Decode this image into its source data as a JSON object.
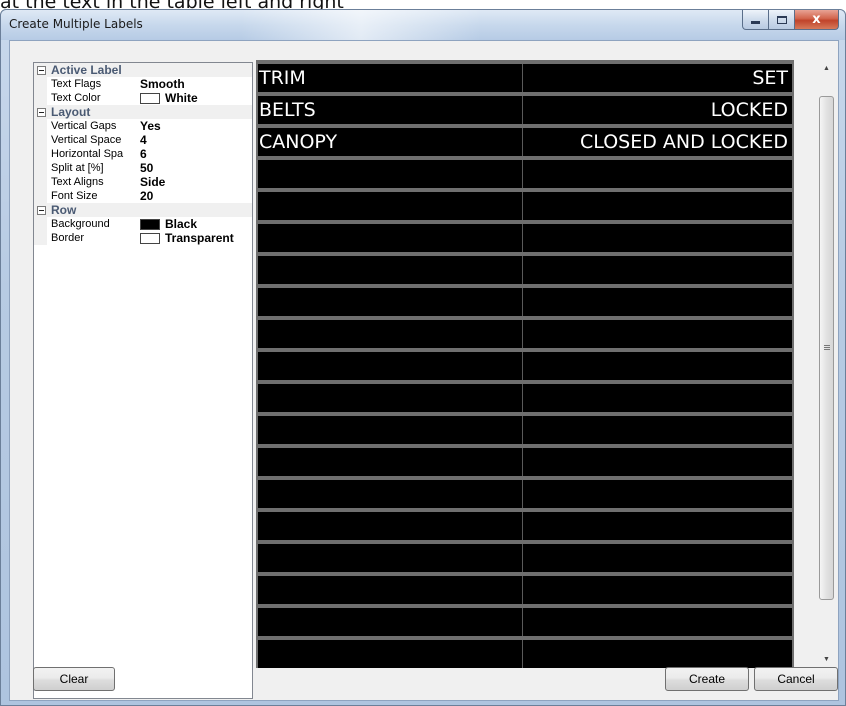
{
  "backdrop_text": "at the text in the table left and right",
  "window": {
    "title": "Create Multiple Labels",
    "minimize_glyph": "",
    "maximize_glyph": "",
    "close_glyph": "x"
  },
  "property_grid": {
    "categories": [
      {
        "label": "Active Label",
        "properties": [
          {
            "name": "Text Flags",
            "value": "Smooth"
          },
          {
            "name": "Text Color",
            "value": "White",
            "swatch": "#ffffff"
          }
        ]
      },
      {
        "label": "Layout",
        "properties": [
          {
            "name": "Vertical Gaps",
            "value": "Yes"
          },
          {
            "name": "Vertical Space",
            "value": "4"
          },
          {
            "name": "Horizontal Spa",
            "value": "6"
          },
          {
            "name": "Split at [%]",
            "value": "50"
          },
          {
            "name": "Text Aligns",
            "value": "Side"
          },
          {
            "name": "Font Size",
            "value": "20"
          }
        ]
      },
      {
        "label": "Row",
        "properties": [
          {
            "name": "Background",
            "value": "Black",
            "swatch": "#000000"
          },
          {
            "name": "Border",
            "value": "Transparent",
            "swatch": "#ffffff"
          }
        ]
      }
    ]
  },
  "preview": {
    "rows": [
      {
        "left": "TRIM",
        "right": "SET"
      },
      {
        "left": "BELTS",
        "right": "LOCKED"
      },
      {
        "left": "CANOPY",
        "right": "CLOSED AND LOCKED"
      },
      {
        "left": "",
        "right": ""
      },
      {
        "left": "",
        "right": ""
      },
      {
        "left": "",
        "right": ""
      },
      {
        "left": "",
        "right": ""
      },
      {
        "left": "",
        "right": ""
      },
      {
        "left": "",
        "right": ""
      },
      {
        "left": "",
        "right": ""
      },
      {
        "left": "",
        "right": ""
      },
      {
        "left": "",
        "right": ""
      },
      {
        "left": "",
        "right": ""
      },
      {
        "left": "",
        "right": ""
      },
      {
        "left": "",
        "right": ""
      },
      {
        "left": "",
        "right": ""
      },
      {
        "left": "",
        "right": ""
      },
      {
        "left": "",
        "right": ""
      },
      {
        "left": "",
        "right": ""
      },
      {
        "left": "",
        "right": ""
      }
    ],
    "row_background": "#000000",
    "text_color": "#ffffff"
  },
  "scrollbar": {
    "up_glyph": "▲",
    "down_glyph": "▼"
  },
  "buttons": {
    "clear": "Clear",
    "create": "Create",
    "cancel": "Cancel"
  }
}
